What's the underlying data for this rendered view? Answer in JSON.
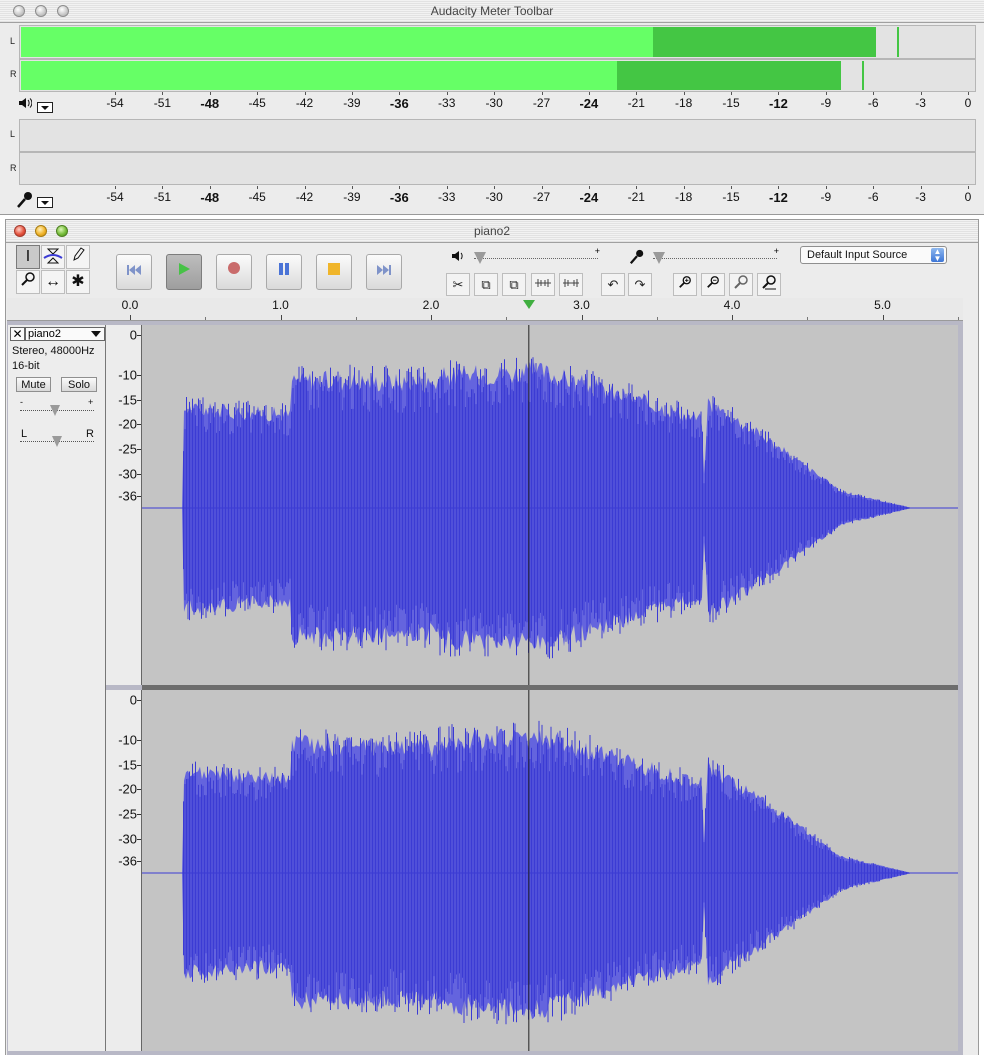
{
  "meter_window": {
    "title": "Audacity Meter Toolbar",
    "play_meter": {
      "left_label": "L",
      "right_label": "R",
      "left_level_db": -20,
      "left_rms_end_db": -5.9,
      "left_peak_db": -4.5,
      "right_level_db": -22.3,
      "right_rms_end_db": -8.1,
      "right_peak_db": -6.7
    },
    "record_meter": {
      "left_label": "L",
      "right_label": "R"
    },
    "db_scale": [
      "-54",
      "-51",
      "-48",
      "-45",
      "-42",
      "-39",
      "-36",
      "-33",
      "-30",
      "-27",
      "-24",
      "-21",
      "-18",
      "-15",
      "-12",
      "-9",
      "-6",
      "-3",
      "0"
    ],
    "bold_ticks": [
      "-48",
      "-36",
      "-24",
      "-12"
    ],
    "speaker_icon": "speaker-icon",
    "mic_icon": "microphone-icon",
    "colors": {
      "meter_bright": "#66ff66",
      "meter_dark": "#44c644",
      "meter_bg": "#e3e3e3"
    }
  },
  "main_window": {
    "title": "piano2",
    "tools": [
      "selection-tool",
      "envelope-tool",
      "draw-tool",
      "zoom-tool",
      "time-shift-tool",
      "multi-tool"
    ],
    "transport": [
      "skip-to-start",
      "play",
      "record",
      "pause",
      "stop",
      "skip-to-end"
    ],
    "edit_tools": [
      "trim-outside",
      "silence-selection",
      "cut",
      "copy",
      "paste",
      "undo",
      "redo",
      "zoom-in",
      "zoom-out",
      "fit-selection",
      "fit-project"
    ],
    "playback_volume_icon": "speaker-icon",
    "input_volume_icon": "microphone-icon",
    "input_source": "Default Input Source",
    "slider_minus": "-",
    "slider_plus": "+",
    "ruler_labels": [
      "0.0",
      "1.0",
      "2.0",
      "3.0",
      "4.0",
      "5.0"
    ],
    "playhead_seconds": 2.65,
    "colors": {
      "waveform": "#3b3bd4",
      "waveform_fill": "#6464de",
      "track_bg": "#c4c4c4"
    }
  },
  "track": {
    "name": "piano2",
    "info": "Stereo, 48000Hz",
    "bit_depth": "16-bit",
    "mute_label": "Mute",
    "solo_label": "Solo",
    "gain_minus": "-",
    "gain_plus": "+",
    "pan_left": "L",
    "pan_right": "R",
    "close_icon": "close-icon",
    "menu_icon": "dropdown-arrow-icon",
    "db_labels": [
      "0",
      "-10",
      "-15",
      "-20",
      "-25",
      "-30",
      "-36"
    ]
  }
}
